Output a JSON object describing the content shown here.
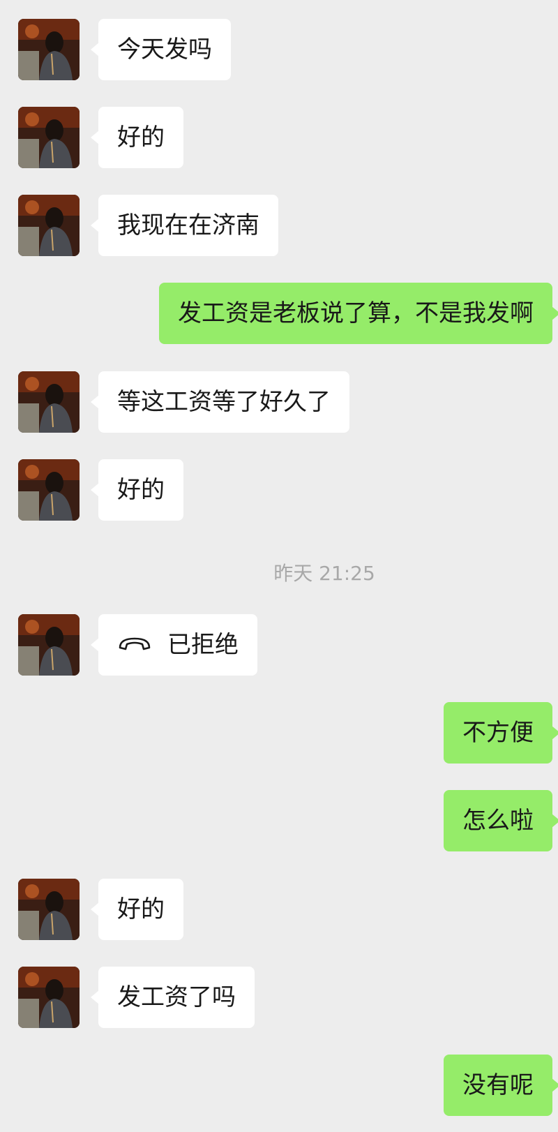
{
  "messages": [
    {
      "id": 1,
      "side": "in",
      "text": "今天发吗"
    },
    {
      "id": 2,
      "side": "in",
      "text": "好的"
    },
    {
      "id": 3,
      "side": "in",
      "text": "我现在在济南"
    },
    {
      "id": 4,
      "side": "out",
      "text": "发工资是老板说了算，不是我发啊"
    },
    {
      "id": 5,
      "side": "in",
      "text": "等这工资等了好久了"
    },
    {
      "id": 6,
      "side": "in",
      "text": "好的"
    },
    {
      "id": 7,
      "side": "in",
      "text": "已拒绝",
      "icon": "phone-hangup-icon"
    },
    {
      "id": 8,
      "side": "out",
      "text": "不方便"
    },
    {
      "id": 9,
      "side": "out",
      "text": "怎么啦"
    },
    {
      "id": 10,
      "side": "in",
      "text": "好的"
    },
    {
      "id": 11,
      "side": "in",
      "text": "发工资了吗"
    },
    {
      "id": 12,
      "side": "out",
      "text": "没有呢"
    }
  ],
  "timestamp": "昨天 21:25",
  "colors": {
    "background": "#ededed",
    "incoming_bubble": "#ffffff",
    "outgoing_bubble": "#95ec69",
    "timestamp_text": "#a8a8a8"
  }
}
